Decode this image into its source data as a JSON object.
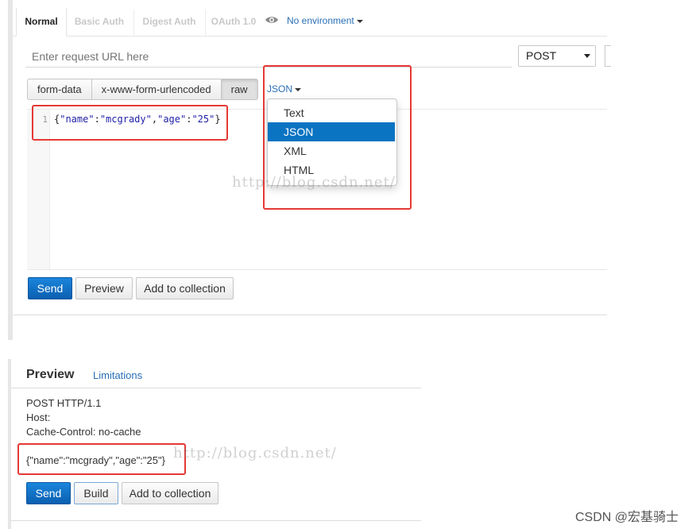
{
  "tabs": [
    "Normal",
    "Basic Auth",
    "Digest Auth",
    "OAuth 1.0"
  ],
  "environment": "No environment",
  "request": {
    "url_placeholder": "Enter request URL here",
    "method": "POST"
  },
  "body_modes": [
    "form-data",
    "x-www-form-urlencoded",
    "raw"
  ],
  "body_format": {
    "selected": "JSON",
    "options": [
      "Text",
      "JSON",
      "XML",
      "HTML"
    ]
  },
  "editor": {
    "line_number": "1",
    "code_tokens": [
      "{",
      "\"name\"",
      ":",
      "\"mcgrady\"",
      ",",
      "\"age\"",
      ":",
      "\"25\"",
      "}"
    ]
  },
  "actions": {
    "send": "Send",
    "preview": "Preview",
    "add_to_collection": "Add to collection"
  },
  "watermark": "http://blog.csdn.net/",
  "preview_panel": {
    "title": "Preview",
    "limitations": "Limitations",
    "lines": [
      "POST HTTP/1.1",
      "Host:",
      "Cache-Control: no-cache"
    ],
    "body": "{\"name\":\"mcgrady\",\"age\":\"25\"}",
    "send": "Send",
    "build": "Build",
    "add_to_collection": "Add to collection"
  },
  "credit": "CSDN @宏基骑士",
  "colors": {
    "accent": "#0a74c2",
    "link": "#2a6fb6",
    "highlight_box": "#e53935"
  }
}
